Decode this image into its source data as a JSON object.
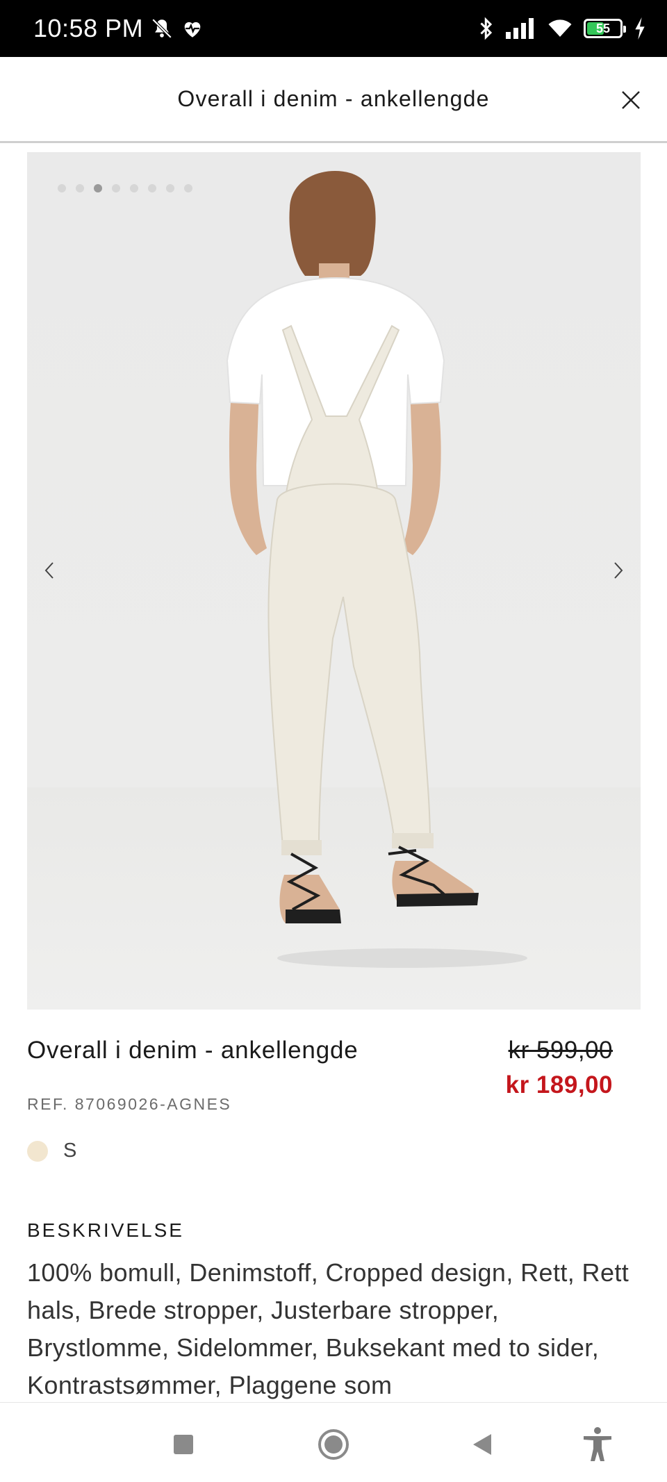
{
  "status_bar": {
    "time": "10:58 PM",
    "battery_percent": "55",
    "battery_level": 0.55,
    "icons": [
      "mute-icon",
      "health-icon",
      "bluetooth-icon",
      "signal-icon",
      "wifi-icon",
      "battery-icon",
      "charging-icon"
    ]
  },
  "header": {
    "title": "Overall i denim - ankellengde"
  },
  "gallery": {
    "total_images": 8,
    "active_index": 2
  },
  "product": {
    "name": "Overall i denim - ankellengde",
    "price_old": "kr 599,00",
    "price_new": "kr 189,00",
    "ref": "REF. 87069026-AGNES",
    "color_swatch": "#f2e6cf",
    "size": "S"
  },
  "description": {
    "title": "BESKRIVELSE",
    "text": "100% bomull, Denimstoff, Cropped design, Rett, Rett hals, Brede stropper, Justerbare stropper, Brystlomme, Sidelommer, Buksekant med to sider, Kontrastsømmer, Plaggene som"
  },
  "colors": {
    "sale_red": "#c4161c",
    "battery_green": "#34c759"
  }
}
